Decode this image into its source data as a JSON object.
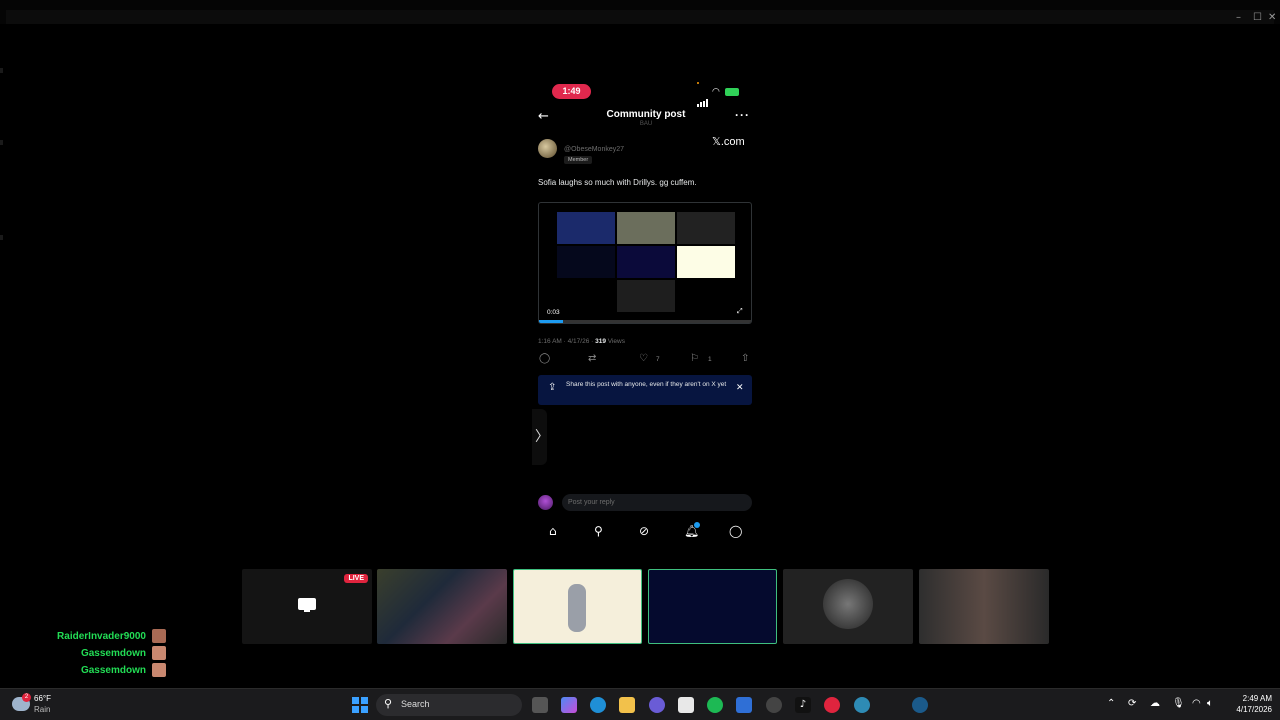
{
  "window": {
    "controls": [
      "–",
      "☐",
      "✕"
    ]
  },
  "phone": {
    "status_time": "1:49",
    "header": {
      "title": "Community post",
      "subtitle": "BAU"
    },
    "post": {
      "username": "@ObeseMonkey27",
      "badge": "Member",
      "watermark": "𝕏.com",
      "text": "Sofia laughs so much with Drillys. gg cuffem.",
      "video_time": "0:03",
      "video_progress": 0.11,
      "meta_time": "1:16 AM · 4/17/26 · ",
      "views_count": "319",
      "views_label": " Views"
    },
    "actions": {
      "likes": "7",
      "bookmarks": "1"
    },
    "share_banner": {
      "text": "Share this post with anyone, even if they aren't on X yet"
    },
    "reply": {
      "placeholder": "Post your reply"
    },
    "nav": [
      "home",
      "search",
      "grok",
      "notifications",
      "messages"
    ]
  },
  "stream": {
    "live_badge": "LIVE",
    "tiles": [
      "screen-share",
      "webcam-streamer",
      "figure-skater",
      "dark-blue-cam",
      "scientology-cam",
      "webcam-woman"
    ]
  },
  "chat": [
    {
      "name": "RaiderInvader9000"
    },
    {
      "name": "Gassemdown"
    },
    {
      "name": "Gassemdown"
    }
  ],
  "taskbar": {
    "weather_badge": "2",
    "temperature": "66°F",
    "condition": "Rain",
    "search_label": "Search",
    "clock_time": "2:49 AM",
    "clock_date": "4/17/2026"
  },
  "colors": {
    "accent": "#1d9bf0",
    "live": "#e0243e",
    "chat_name": "#22dd55",
    "status_time": "#e0284d"
  }
}
